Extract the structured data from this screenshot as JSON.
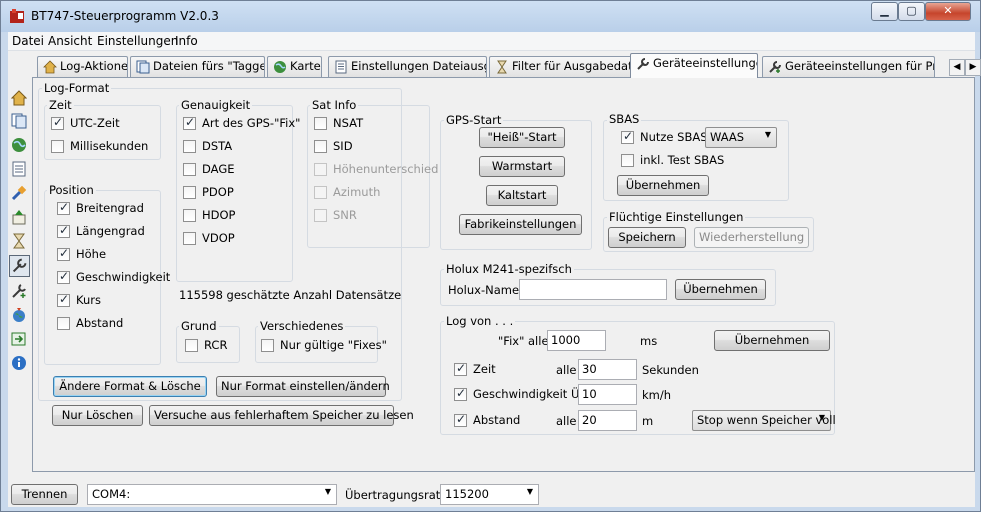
{
  "window": {
    "title": "BT747-Steuerprogramm V2.0.3",
    "min": "▁",
    "max": "▢",
    "close": "✕"
  },
  "menu": [
    "Datei",
    "Ansicht",
    "Einstellungen",
    "Info"
  ],
  "tabs": [
    {
      "label": "Log-Aktionen",
      "icon": "home-icon"
    },
    {
      "label": "Dateien fürs \"Taggen\"",
      "icon": "files-icon"
    },
    {
      "label": "Karte",
      "icon": "globe-icon"
    },
    {
      "label": "Einstellungen Dateiausgabe",
      "icon": "document-icon"
    },
    {
      "label": "Filter für Ausgabedaten",
      "icon": "hourglass-icon"
    },
    {
      "label": "Geräteeinstellungen",
      "icon": "wrench-icon"
    },
    {
      "label": "Geräteeinstellungen für Profis",
      "icon": "wrench-plus-icon"
    }
  ],
  "tab_scroll": {
    "left": "◀",
    "right": "▶"
  },
  "log_format": {
    "title": "Log-Format",
    "zeit": {
      "title": "Zeit",
      "items": [
        {
          "label": "UTC-Zeit",
          "checked": true
        },
        {
          "label": "Millisekunden",
          "checked": false
        }
      ]
    },
    "genauigkeit": {
      "title": "Genauigkeit",
      "items": [
        {
          "label": "Art des GPS-\"Fix\"",
          "checked": true
        },
        {
          "label": "DSTA",
          "checked": false
        },
        {
          "label": "DAGE",
          "checked": false
        },
        {
          "label": "PDOP",
          "checked": false
        },
        {
          "label": "HDOP",
          "checked": false
        },
        {
          "label": "VDOP",
          "checked": false
        }
      ]
    },
    "sat_info": {
      "title": "Sat Info",
      "items": [
        {
          "label": "NSAT",
          "checked": false,
          "disabled": false
        },
        {
          "label": "SID",
          "checked": false,
          "disabled": false
        },
        {
          "label": "Höhenunterschied",
          "checked": false,
          "disabled": true
        },
        {
          "label": "Azimuth",
          "checked": false,
          "disabled": true
        },
        {
          "label": "SNR",
          "checked": false,
          "disabled": true
        }
      ]
    },
    "position": {
      "title": "Position",
      "items": [
        {
          "label": "Breitengrad",
          "checked": true
        },
        {
          "label": "Längengrad",
          "checked": true
        },
        {
          "label": "Höhe",
          "checked": true
        },
        {
          "label": "Geschwindigkeit",
          "checked": true
        },
        {
          "label": "Kurs",
          "checked": true
        },
        {
          "label": "Abstand",
          "checked": false
        }
      ]
    },
    "estimate": "115598 geschätzte Anzahl Datensätze",
    "grund": {
      "title": "Grund",
      "items": [
        {
          "label": "RCR",
          "checked": false
        }
      ]
    },
    "verschiedenes": {
      "title": "Verschiedenes",
      "items": [
        {
          "label": "Nur gültige \"Fixes\"",
          "checked": false
        }
      ]
    },
    "buttons": {
      "change_delete": "Ändere Format & Lösche",
      "format_only": "Nur Format einstellen/ändern",
      "delete_only": "Nur Löschen",
      "read_faulty": "Versuche aus fehlerhaftem Speicher zu lesen"
    }
  },
  "gps_start": {
    "title": "GPS-Start",
    "hot": "\"Heiß\"-Start",
    "warm": "Warmstart",
    "cold": "Kaltstart",
    "factory": "Fabrikeinstellungen"
  },
  "sbas": {
    "title": "SBAS",
    "use": {
      "label": "Nutze SBAS",
      "checked": true
    },
    "mode": "WAAS",
    "test": {
      "label": "inkl. Test SBAS",
      "checked": false
    },
    "apply": "Übernehmen"
  },
  "volatile": {
    "title": "Flüchtige Einstellungen",
    "save": "Speichern",
    "restore": "Wiederherstellung"
  },
  "holux": {
    "title": "Holux M241-spezifsch",
    "name_label": "Holux-Name:",
    "name_value": "",
    "apply": "Übernehmen"
  },
  "log_by": {
    "title": "Log von . . .",
    "fix_label": "\"Fix\" alle",
    "fix_value": "1000",
    "fix_unit": "ms",
    "apply": "Übernehmen",
    "time": {
      "label": "Zeit",
      "checked": true,
      "each": "alle",
      "value": "30",
      "unit": "Sekunden"
    },
    "speed": {
      "label": "Geschwindigkeit Über",
      "checked": true,
      "value": "10",
      "unit": "km/h"
    },
    "distance": {
      "label": "Abstand",
      "checked": true,
      "each": "alle",
      "value": "20",
      "unit": "m"
    },
    "stop_mode": "Stop wenn Speicher voll"
  },
  "status": {
    "disconnect": "Trennen",
    "port": "COM4:",
    "baud_label": "Übertragungsrate:",
    "baud": "115200"
  }
}
